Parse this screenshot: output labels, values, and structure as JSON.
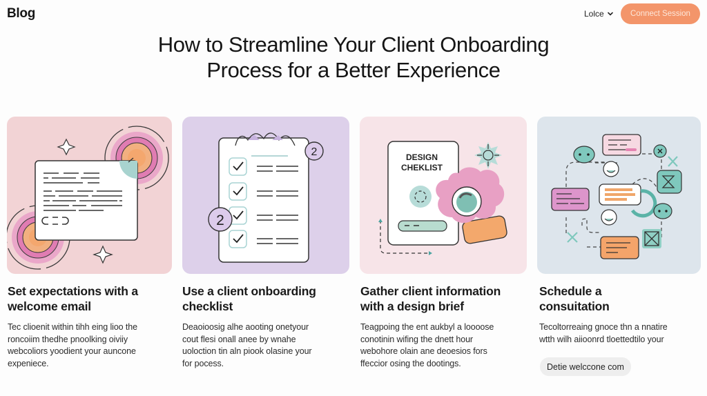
{
  "header": {
    "logo": "Blog",
    "language_selector": "Lolce",
    "cta_button": "Connect Session"
  },
  "article": {
    "title_line1": "How to Streamline Your Client Onboarding",
    "title_line2": "Process for a Better Experience"
  },
  "cards": [
    {
      "title_line1": "Set expectations with a",
      "title_line2": "welcome email",
      "body": [
        "Tec clioenit within tihh eing lioo the",
        "roncoiim thedhe pnoolking oiviiy",
        "webcoliors yoodient your auncone",
        "expeniece."
      ],
      "illustration": "welcome-email-illustration"
    },
    {
      "title_line1": "Use a client onboarding",
      "title_line2": "checklist",
      "body": [
        "Deaoioosig alhe aooting onetyour",
        "cout flesi onall anee by wnahe",
        "uoloction tin aln piook olasine your",
        "for pocess."
      ],
      "illustration": "checklist-illustration",
      "badge_numbers": [
        "2",
        "2"
      ]
    },
    {
      "title_line1": "Gather client information",
      "title_line2": "with a design brief",
      "body": [
        "Teagpoing the ent aukbyl a loooose",
        "conotinin wifing the dnett hour",
        "webohore olain ane deoesios fors",
        "ffeccior osing the dootings."
      ],
      "illustration": "design-brief-illustration",
      "illustration_text": [
        "DESIGN",
        "CHEKLIST"
      ]
    },
    {
      "title_line1": "Schedule a",
      "title_line2": "consuitation",
      "body": [
        "Tecoltorreaing gnoce thn a nnatire",
        "wtth wilh aiioonrd tloettedtilo your"
      ],
      "illustration": "consultation-flow-illustration",
      "chip": "Detie welccone com"
    }
  ],
  "colors": {
    "accent": "#f3956a",
    "card1_bg": "#f2d3d5",
    "card2_bg": "#ddd0ea",
    "card3_bg": "#f7e4e8",
    "card4_bg": "#dde5ec",
    "teal": "#8fcfc4",
    "pink": "#e48ab8",
    "orange": "#f3a86c"
  }
}
